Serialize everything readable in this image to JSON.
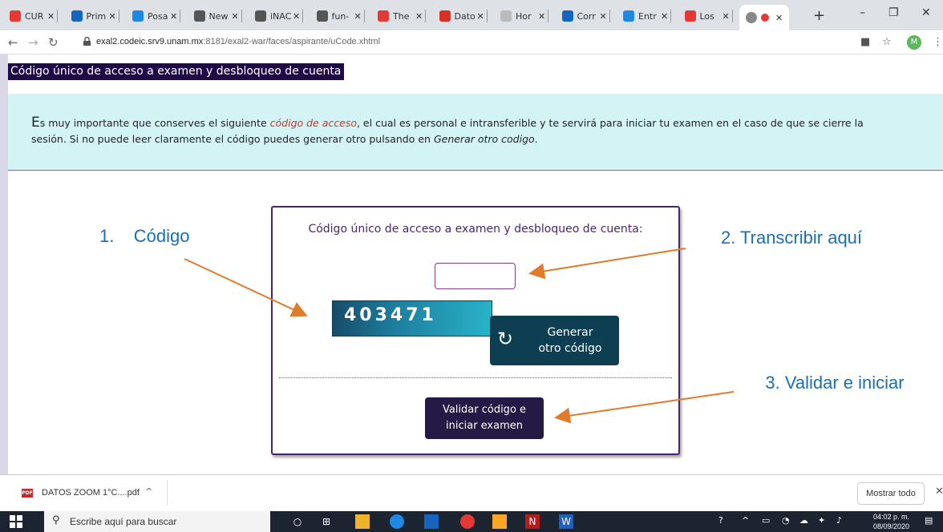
{
  "browser": {
    "tabs": [
      {
        "title": "CUR",
        "color": "#e53935"
      },
      {
        "title": "Prim",
        "color": "#1565c0"
      },
      {
        "title": "Posa",
        "color": "#1e88e5"
      },
      {
        "title": "New",
        "color": "#555555"
      },
      {
        "title": "iNAC",
        "color": "#555555"
      },
      {
        "title": "fun-",
        "color": "#555555"
      },
      {
        "title": "The",
        "color": "#e53935"
      },
      {
        "title": "Dato",
        "color": "#d93025"
      },
      {
        "title": "Hor",
        "color": "#bbbbbb"
      },
      {
        "title": "Corr",
        "color": "#1565c0"
      },
      {
        "title": "Entr",
        "color": "#1e88e5"
      },
      {
        "title": "Los",
        "color": "#e53935"
      }
    ],
    "close_glyph": "✕",
    "new_tab_glyph": "+",
    "url_host": "exal2.codeic.srv9.unam.mx",
    "url_rest": ":8181/exal2-war/faces/aspirante/uCode.xhtml",
    "avatar_letter": "M"
  },
  "page": {
    "heading": "Código único de acceso a examen y desbloqueo de cuenta",
    "notice": {
      "first_letter": "E",
      "part1": "s muy importante que conserves el siguiente ",
      "highlight": "código de acceso",
      "part2": ", el cual es personal e intransferible y te servirá para iniciar tu examen en el caso de que se cierre la sesión. Si no puede leer claramente el código puedes generar otro pulsando en ",
      "italic": "Generar otro codigo",
      "part3": "."
    },
    "card": {
      "title": "Código único de acceso a examen y desbloqueo de cuenta:",
      "input_value": "",
      "captcha_code": "403471",
      "regen_label_line1": "Generar",
      "regen_label_line2": "otro código",
      "validate_line1": "Validar código e",
      "validate_line2": "iniciar examen"
    }
  },
  "annotations": {
    "step1": "1.    Código",
    "step2": "2. Transcribir aquí",
    "step3": "3. Validar e iniciar",
    "arrow_color": "#e07b2a"
  },
  "downloads": {
    "file_name": "DATOS ZOOM 1°C....pdf",
    "file_badge": "PDF",
    "show_all": "Mostrar todo"
  },
  "taskbar": {
    "search_placeholder": "Escribe aquí para buscar",
    "time": "04:02 p. m.",
    "date": "08/09/2020"
  }
}
